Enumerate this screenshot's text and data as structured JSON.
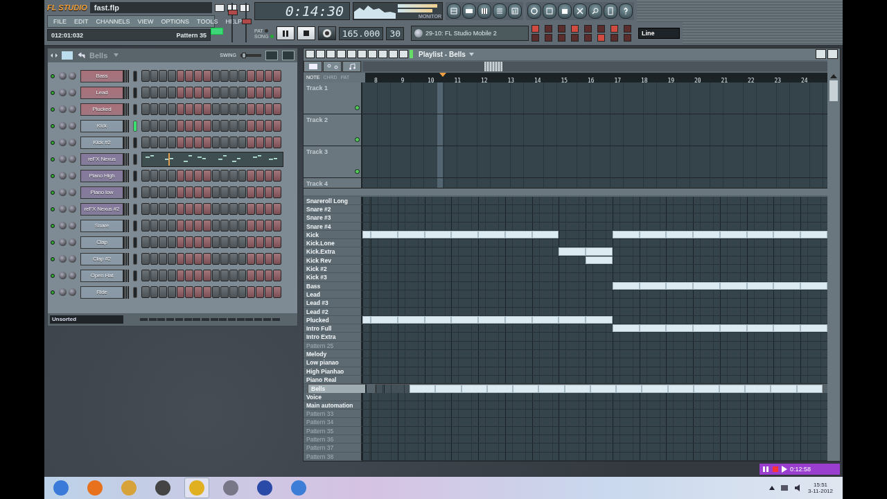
{
  "toolbar": {
    "logo": "FL STUDIO",
    "file_name": "fast.flp",
    "menu": [
      "FILE",
      "EDIT",
      "CHANNELS",
      "VIEW",
      "OPTIONS",
      "TOOLS",
      "HELP"
    ],
    "position": "012:01:032",
    "hint": "Pattern 35",
    "time": "0:14:30",
    "monitor_label": "MONITOR",
    "transport_modes": [
      {
        "label": "PAT",
        "selected": false
      },
      {
        "label": "SONG",
        "selected": true
      }
    ],
    "tempo": "165.000",
    "pattern_number": "30",
    "preset": "29-10: FL Studio Mobile 2",
    "snap": "Line",
    "volume": {
      "level": 0.8
    },
    "pitch": {
      "level": 0.55
    }
  },
  "channel_rack": {
    "title": "Bells",
    "swing_label": "SWING",
    "swing": {
      "level": 0.1
    },
    "filter": "Unsorted",
    "channels": [
      {
        "name": "Bass",
        "color": "#a8707a",
        "selected": false,
        "kind": "steps"
      },
      {
        "name": "Lead",
        "color": "#a8707a",
        "selected": false,
        "kind": "steps"
      },
      {
        "name": "Plucked",
        "color": "#a8707a",
        "selected": false,
        "kind": "steps"
      },
      {
        "name": "Kick",
        "color": "#8c9ba8",
        "selected": true,
        "kind": "steps"
      },
      {
        "name": "Kick #2",
        "color": "#8c9ba8",
        "selected": false,
        "kind": "steps"
      },
      {
        "name": "reFX Nexus",
        "color": "#85789c",
        "selected": false,
        "kind": "pianoroll"
      },
      {
        "name": "Piano High",
        "color": "#85789c",
        "selected": false,
        "kind": "steps"
      },
      {
        "name": "Piano low",
        "color": "#85789c",
        "selected": false,
        "kind": "steps"
      },
      {
        "name": "reFX Nexus #2",
        "color": "#85789c",
        "selected": false,
        "kind": "steps"
      },
      {
        "name": "Snare",
        "color": "#8c9ba8",
        "selected": false,
        "kind": "steps"
      },
      {
        "name": "Clap",
        "color": "#8c9ba8",
        "selected": false,
        "kind": "steps"
      },
      {
        "name": "Clap #2",
        "color": "#8c9ba8",
        "selected": false,
        "kind": "steps"
      },
      {
        "name": "Open Hat",
        "color": "#8c9ba8",
        "selected": false,
        "kind": "steps"
      },
      {
        "name": "Ride",
        "color": "#8c9ba8",
        "selected": false,
        "kind": "steps"
      }
    ]
  },
  "playlist": {
    "title": "Playlist - Bells",
    "browser_modes": [
      {
        "label": "NOTE",
        "selected": true
      },
      {
        "label": "CHRD",
        "selected": false
      },
      {
        "label": "PAT",
        "selected": false
      }
    ],
    "ruler": [
      "8",
      "9",
      "10",
      "11",
      "12",
      "13",
      "14",
      "15",
      "16",
      "17",
      "18",
      "19",
      "20",
      "21",
      "22",
      "23",
      "24"
    ],
    "tracks": [
      "Track 1",
      "Track 2",
      "Track 3",
      "Track 4"
    ],
    "patterns": [
      {
        "name": "Snareroll Long",
        "empty": false,
        "selected": false,
        "filled_bars": [
          false,
          false,
          false,
          false,
          false,
          false,
          false,
          false,
          false,
          false,
          false,
          false,
          false,
          false,
          false,
          false,
          false
        ]
      },
      {
        "name": "Snare #2",
        "empty": false,
        "selected": false,
        "filled_bars": [
          false,
          false,
          false,
          false,
          false,
          false,
          false,
          false,
          false,
          false,
          false,
          false,
          false,
          false,
          false,
          false,
          false
        ]
      },
      {
        "name": "Snare #3",
        "empty": false,
        "selected": false,
        "filled_bars": [
          false,
          false,
          false,
          false,
          false,
          false,
          false,
          false,
          false,
          false,
          false,
          false,
          false,
          false,
          false,
          false,
          false
        ]
      },
      {
        "name": "Snare #4",
        "empty": false,
        "selected": false,
        "filled_bars": [
          false,
          false,
          false,
          false,
          false,
          false,
          false,
          false,
          false,
          false,
          false,
          false,
          false,
          false,
          false,
          false,
          false
        ]
      },
      {
        "name": "Kick",
        "empty": false,
        "selected": false,
        "filled_bars": [
          true,
          true,
          true,
          true,
          true,
          true,
          true,
          false,
          false,
          true,
          true,
          true,
          true,
          true,
          true,
          true,
          true
        ]
      },
      {
        "name": "Kick.Lone",
        "empty": false,
        "selected": false,
        "filled_bars": [
          false,
          false,
          false,
          false,
          false,
          false,
          false,
          false,
          false,
          false,
          false,
          false,
          false,
          false,
          false,
          false,
          false
        ]
      },
      {
        "name": "Kick.Extra",
        "empty": false,
        "selected": false,
        "filled_bars": [
          false,
          false,
          false,
          false,
          false,
          false,
          false,
          true,
          true,
          false,
          false,
          false,
          false,
          false,
          false,
          false,
          false
        ]
      },
      {
        "name": "Kick Rev",
        "empty": false,
        "selected": false,
        "filled_bars": [
          false,
          false,
          false,
          false,
          false,
          false,
          false,
          false,
          true,
          false,
          false,
          false,
          false,
          false,
          false,
          false,
          false
        ]
      },
      {
        "name": "Kick #2",
        "empty": false,
        "selected": false,
        "filled_bars": [
          false,
          false,
          false,
          false,
          false,
          false,
          false,
          false,
          false,
          false,
          false,
          false,
          false,
          false,
          false,
          false,
          false
        ]
      },
      {
        "name": "Kick #3",
        "empty": false,
        "selected": false,
        "filled_bars": [
          false,
          false,
          false,
          false,
          false,
          false,
          false,
          false,
          false,
          false,
          false,
          false,
          false,
          false,
          false,
          false,
          false
        ]
      },
      {
        "name": "Bass",
        "empty": false,
        "selected": false,
        "filled_bars": [
          false,
          false,
          false,
          false,
          false,
          false,
          false,
          false,
          false,
          true,
          true,
          true,
          true,
          true,
          true,
          true,
          true
        ]
      },
      {
        "name": "Lead",
        "empty": false,
        "selected": false,
        "filled_bars": [
          false,
          false,
          false,
          false,
          false,
          false,
          false,
          false,
          false,
          false,
          false,
          false,
          false,
          false,
          false,
          false,
          false
        ]
      },
      {
        "name": "Lead #3",
        "empty": false,
        "selected": false,
        "filled_bars": [
          false,
          false,
          false,
          false,
          false,
          false,
          false,
          false,
          false,
          false,
          false,
          false,
          false,
          false,
          false,
          false,
          false
        ]
      },
      {
        "name": "Lead #2",
        "empty": false,
        "selected": false,
        "filled_bars": [
          false,
          false,
          false,
          false,
          false,
          false,
          false,
          false,
          false,
          false,
          false,
          false,
          false,
          false,
          false,
          false,
          false
        ]
      },
      {
        "name": "Plucked",
        "empty": false,
        "selected": false,
        "filled_bars": [
          true,
          true,
          true,
          true,
          true,
          true,
          true,
          true,
          true,
          false,
          false,
          false,
          false,
          false,
          false,
          false,
          false
        ]
      },
      {
        "name": "Intro Full",
        "empty": false,
        "selected": false,
        "filled_bars": [
          false,
          false,
          false,
          false,
          false,
          false,
          false,
          false,
          false,
          true,
          true,
          true,
          true,
          true,
          true,
          true,
          true
        ]
      },
      {
        "name": "Intro Extra",
        "empty": false,
        "selected": false,
        "filled_bars": [
          false,
          false,
          false,
          false,
          false,
          false,
          false,
          false,
          false,
          false,
          false,
          false,
          false,
          false,
          false,
          false,
          false
        ]
      },
      {
        "name": "Pattern 25",
        "empty": true,
        "selected": false,
        "filled_bars": [
          false,
          false,
          false,
          false,
          false,
          false,
          false,
          false,
          false,
          false,
          false,
          false,
          false,
          false,
          false,
          false,
          false
        ]
      },
      {
        "name": "Melody",
        "empty": false,
        "selected": false,
        "filled_bars": [
          false,
          false,
          false,
          false,
          false,
          false,
          false,
          false,
          false,
          false,
          false,
          false,
          false,
          false,
          false,
          false,
          false
        ]
      },
      {
        "name": "Low pianao",
        "empty": false,
        "selected": false,
        "filled_bars": [
          false,
          false,
          false,
          false,
          false,
          false,
          false,
          false,
          false,
          false,
          false,
          false,
          false,
          false,
          false,
          false,
          false
        ]
      },
      {
        "name": "High Pianhao",
        "empty": false,
        "selected": false,
        "filled_bars": [
          false,
          false,
          false,
          false,
          false,
          false,
          false,
          false,
          false,
          false,
          false,
          false,
          false,
          false,
          false,
          false,
          false
        ]
      },
      {
        "name": "Piano Real",
        "empty": false,
        "selected": false,
        "filled_bars": [
          false,
          false,
          false,
          false,
          false,
          false,
          false,
          false,
          false,
          false,
          false,
          false,
          false,
          false,
          false,
          false,
          false
        ]
      },
      {
        "name": "Bells",
        "empty": false,
        "selected": true,
        "filled_bars": [
          false,
          true,
          true,
          true,
          true,
          true,
          true,
          true,
          true,
          true,
          true,
          true,
          true,
          true,
          true,
          true,
          true
        ]
      },
      {
        "name": "Voice",
        "empty": false,
        "selected": false,
        "filled_bars": [
          false,
          false,
          false,
          false,
          false,
          false,
          false,
          false,
          false,
          false,
          false,
          false,
          false,
          false,
          false,
          false,
          false
        ]
      },
      {
        "name": "Main automation",
        "empty": false,
        "selected": false,
        "filled_bars": [
          false,
          false,
          false,
          false,
          false,
          false,
          false,
          false,
          false,
          false,
          false,
          false,
          false,
          false,
          false,
          false,
          false
        ]
      },
      {
        "name": "Pattern 33",
        "empty": true,
        "selected": false,
        "filled_bars": [
          false,
          false,
          false,
          false,
          false,
          false,
          false,
          false,
          false,
          false,
          false,
          false,
          false,
          false,
          false,
          false,
          false
        ]
      },
      {
        "name": "Pattern 34",
        "empty": true,
        "selected": false,
        "filled_bars": [
          false,
          false,
          false,
          false,
          false,
          false,
          false,
          false,
          false,
          false,
          false,
          false,
          false,
          false,
          false,
          false,
          false
        ]
      },
      {
        "name": "Pattern 35",
        "empty": true,
        "selected": false,
        "filled_bars": [
          false,
          false,
          false,
          false,
          false,
          false,
          false,
          false,
          false,
          false,
          false,
          false,
          false,
          false,
          false,
          false,
          false
        ]
      },
      {
        "name": "Pattern 36",
        "empty": true,
        "selected": false,
        "filled_bars": [
          false,
          false,
          false,
          false,
          false,
          false,
          false,
          false,
          false,
          false,
          false,
          false,
          false,
          false,
          false,
          false,
          false
        ]
      },
      {
        "name": "Pattern 37",
        "empty": true,
        "selected": false,
        "filled_bars": [
          false,
          false,
          false,
          false,
          false,
          false,
          false,
          false,
          false,
          false,
          false,
          false,
          false,
          false,
          false,
          false,
          false
        ]
      },
      {
        "name": "Pattern 38",
        "empty": true,
        "selected": false,
        "filled_bars": [
          false,
          false,
          false,
          false,
          false,
          false,
          false,
          false,
          false,
          false,
          false,
          false,
          false,
          false,
          false,
          false,
          false
        ]
      }
    ]
  },
  "recorder": {
    "time": "0:12:58"
  },
  "taskbar": {
    "time": "15:51",
    "date": "3-11-2012"
  }
}
